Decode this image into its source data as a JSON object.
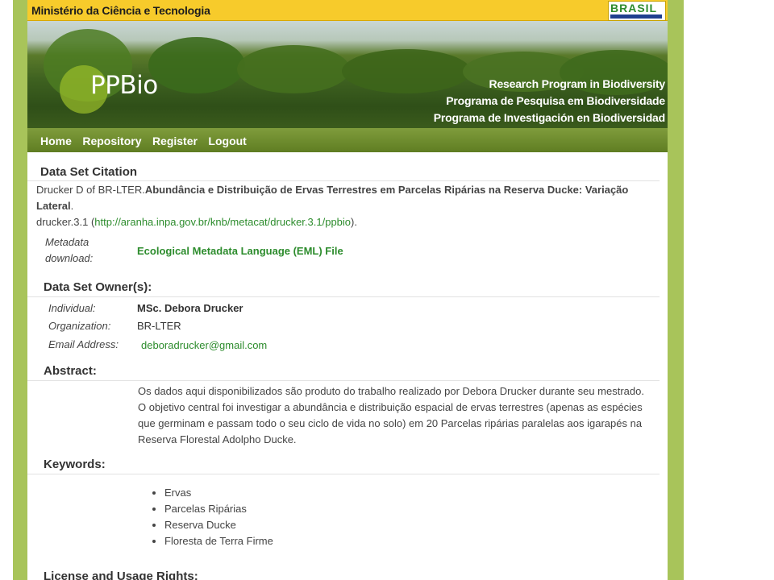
{
  "header": {
    "ministry": "Ministério da Ciência e Tecnologia",
    "brasil_logo": "BRASIL",
    "site_name": "PPBio",
    "taglines": [
      "Research Program in Biodiversity",
      "Programa de Pesquisa em Biodiversidade",
      "Programa de Investigación en Biodiversidad"
    ]
  },
  "nav": {
    "items": [
      "Home",
      "Repository",
      "Register",
      "Logout"
    ]
  },
  "citation": {
    "heading": "Data Set Citation",
    "author": "Drucker D of BR-LTER.",
    "title_line1": "Abundância e Distribuição de Ervas Terrestres em Parcelas Ripárias na Reserva Ducke: Variação",
    "title_line2": "Lateral",
    "period": ".",
    "id": "drucker.3.1",
    "url_prefix": " (",
    "url": "http://aranha.inpa.gov.br/knb/metacat/drucker.3.1/ppbio",
    "url_suffix": ")."
  },
  "metadata": {
    "label_line1": "Metadata",
    "label_line2": "download:",
    "link": "Ecological Metadata Language (EML) File"
  },
  "owner": {
    "heading": "Data Set Owner(s):",
    "individual_label": "Individual:",
    "individual": "MSc. Debora Drucker",
    "organization_label": "Organization:",
    "organization": "BR-LTER",
    "email_label": "Email Address:",
    "email": "deboradrucker@gmail.com"
  },
  "abstract": {
    "heading": "Abstract:",
    "lines": [
      "Os dados aqui disponibilizados são produto do trabalho realizado por Debora Drucker durante seu mestrado.",
      "O objetivo central foi investigar a abundância e distribuição espacial de ervas terrestres (apenas as espécies",
      "que germinam e passam todo o seu ciclo de vida no solo) em 20 Parcelas ripárias paralelas aos igarapés na",
      "Reserva Florestal Adolpho Ducke."
    ]
  },
  "keywords": {
    "heading": "Keywords:",
    "items": [
      "Ervas",
      "Parcelas Ripárias",
      "Reserva Ducke",
      "Floresta de Terra Firme"
    ]
  },
  "license": {
    "heading": "License and Usage Rights:"
  },
  "colors": {
    "topbar": "#f7cb2b",
    "frame": "#a8c45a",
    "nav": "#6a8a2c",
    "link": "#2d8c2d"
  }
}
